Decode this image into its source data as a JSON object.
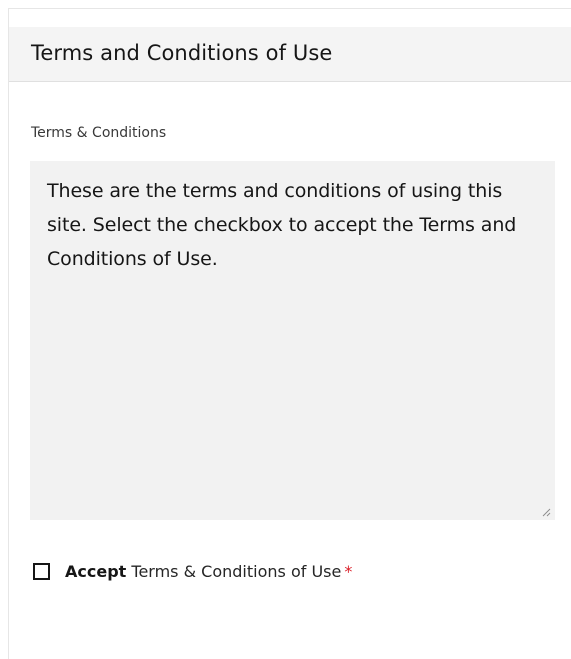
{
  "panel": {
    "title": "Terms and Conditions of Use"
  },
  "terms_field": {
    "label": "Terms & Conditions",
    "value": "These are the terms and conditions of using this site. Select the checkbox to accept the Terms and Conditions of Use."
  },
  "accept_checkbox": {
    "checked": false,
    "label_bold": "Accept",
    "label_rest": " Terms & Conditions of Use",
    "required_marker": "*"
  },
  "colors": {
    "header_bg": "#f4f4f4",
    "textarea_bg": "#f2f2f2",
    "required": "#da1e28",
    "text": "#161616"
  }
}
